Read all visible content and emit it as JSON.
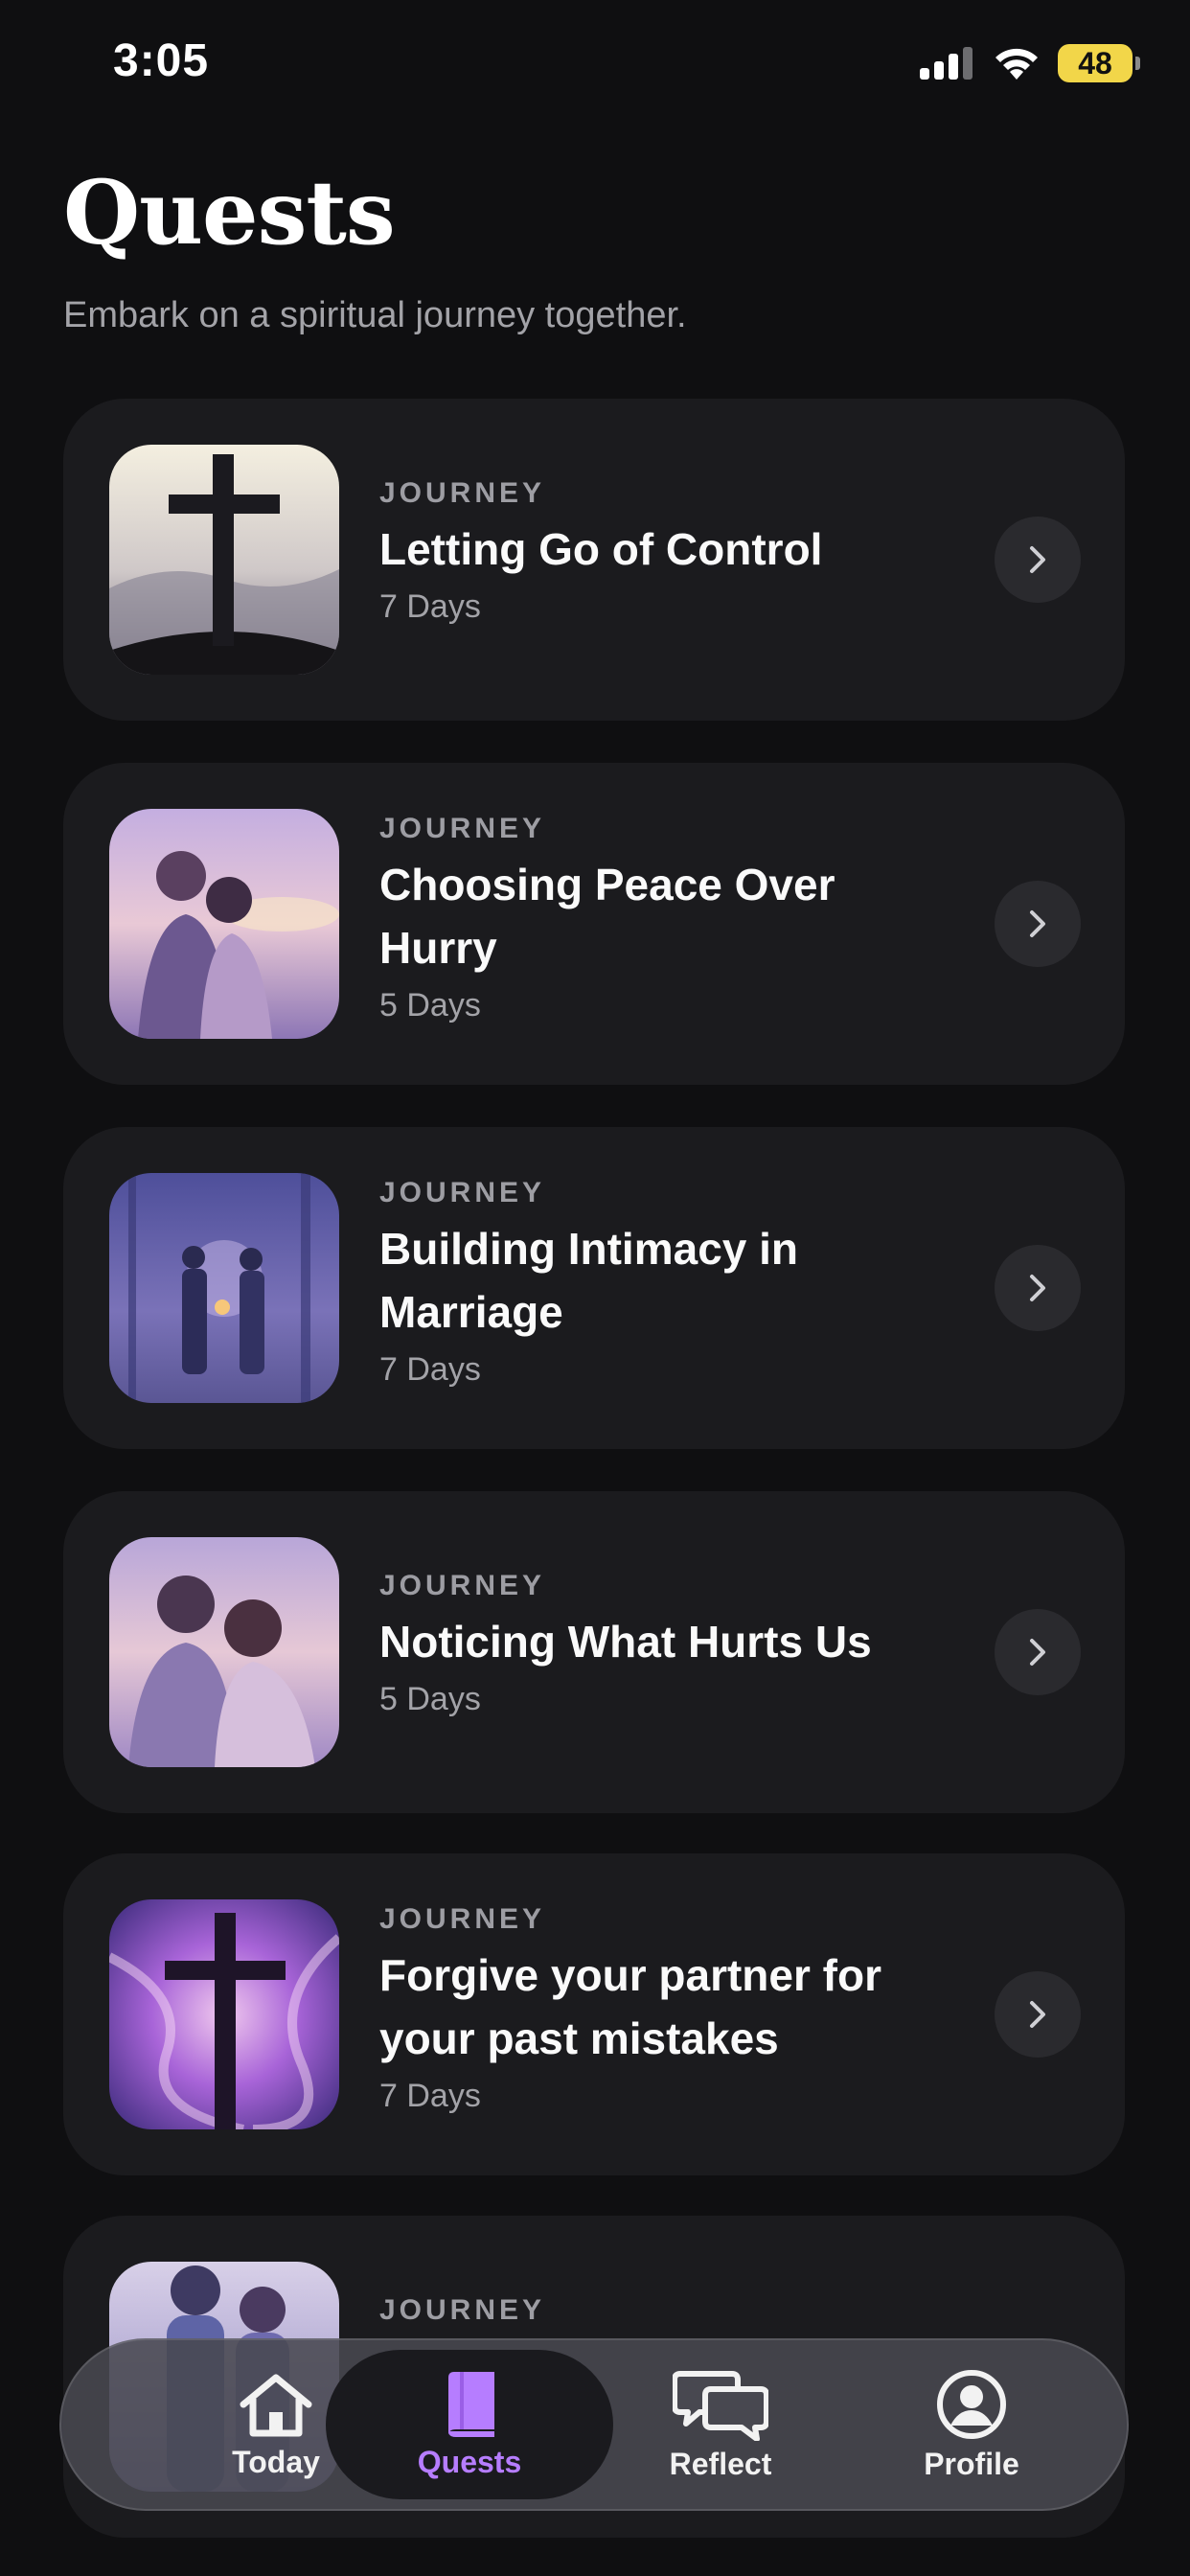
{
  "status": {
    "time": "3:05",
    "battery": "48"
  },
  "header": {
    "title": "Quests",
    "subtitle": "Embark on a spiritual journey together."
  },
  "quests": [
    {
      "type": "JOURNEY",
      "title": "Letting Go of Control",
      "days": "7 Days",
      "image": "cross-sunrise"
    },
    {
      "type": "JOURNEY",
      "title": "Choosing Peace Over Hurry",
      "days": "5 Days",
      "image": "couple-sunset"
    },
    {
      "type": "JOURNEY",
      "title": "Building Intimacy in Marriage",
      "days": "7 Days",
      "image": "couple-lantern-forest"
    },
    {
      "type": "JOURNEY",
      "title": "Noticing What Hurts Us",
      "days": "5 Days",
      "image": "couple-embrace"
    },
    {
      "type": "JOURNEY",
      "title": "Forgive your partner for your past mistakes",
      "days": "7 Days",
      "image": "cross-nebula"
    },
    {
      "type": "JOURNEY",
      "title": "",
      "days": "",
      "image": "couple-walking"
    }
  ],
  "tab_bar": {
    "items": [
      {
        "label": "Today",
        "icon": "home-icon"
      },
      {
        "label": "Quests",
        "icon": "book-icon",
        "active": true
      },
      {
        "label": "Reflect",
        "icon": "chat-bubbles-icon"
      },
      {
        "label": "Profile",
        "icon": "profile-icon"
      }
    ]
  },
  "colors": {
    "background": "#0f0f11",
    "card": "#1b1b1e",
    "accent": "#b67dff",
    "battery": "#f2d649"
  }
}
